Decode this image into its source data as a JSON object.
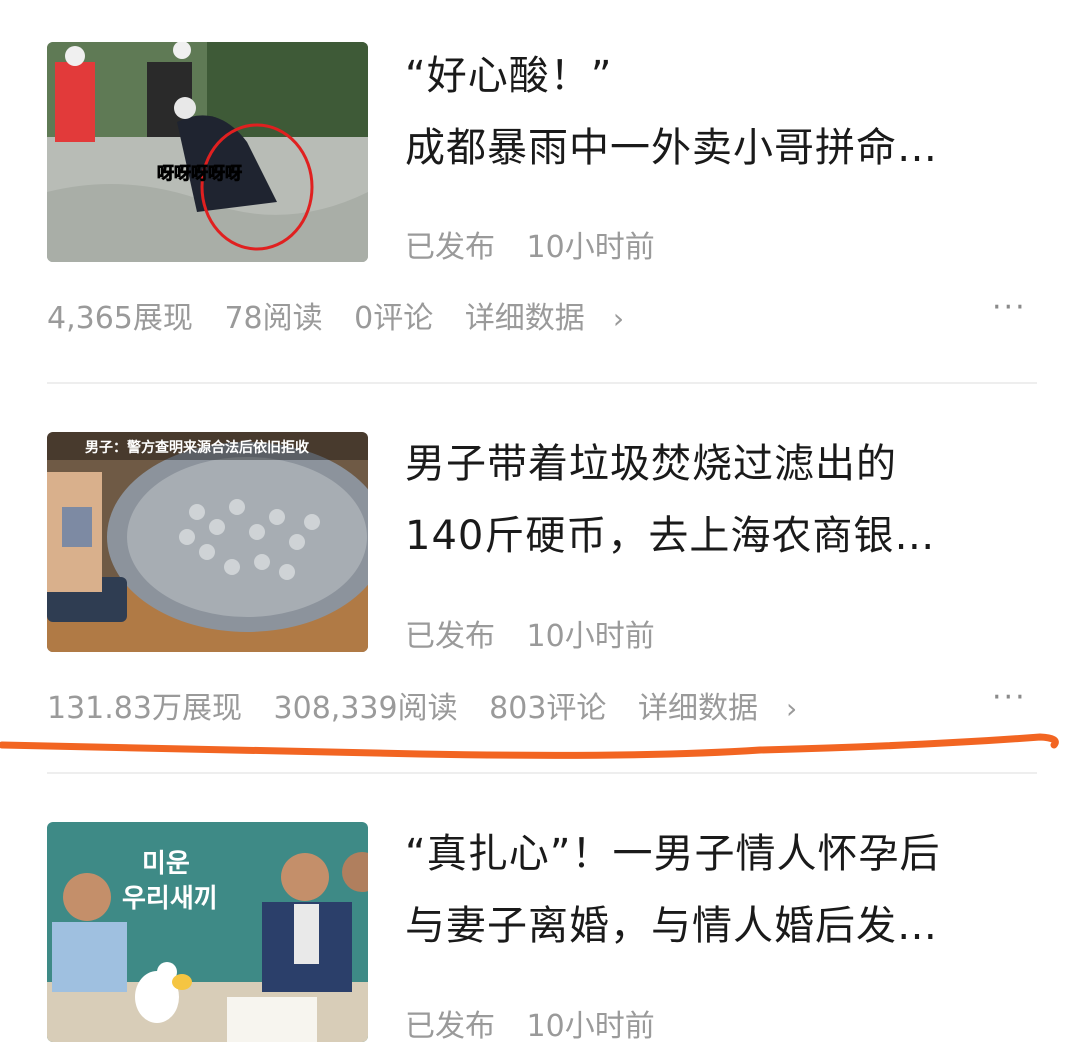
{
  "articles": [
    {
      "title_line1": "“好心酸！”",
      "title_line2": "成都暴雨中一外卖小哥拼命…",
      "status": "已发布",
      "time": "10小时前",
      "impressions": "4,365展现",
      "reads": "78阅读",
      "comments": "0评论",
      "details_label": "详细数据",
      "thumb_caption": "呀呀呀呀呀"
    },
    {
      "title_line1": "男子带着垃圾焚烧过滤出的",
      "title_line2": "140斤硬币，去上海农商银…",
      "status": "已发布",
      "time": "10小时前",
      "impressions": "131.83万展现",
      "reads": "308,339阅读",
      "comments": "803评论",
      "details_label": "详细数据",
      "thumb_caption": "男子：警方查明来源合法后依旧拒收"
    },
    {
      "title_line1": "“真扎心”！一男子情人怀孕后",
      "title_line2": "与妻子离婚，与情人婚后发…",
      "status": "已发布",
      "time": "10小时前",
      "thumb_caption_1": "미운",
      "thumb_caption_2": "우리새끼"
    }
  ],
  "more_icon": "more-dots-icon",
  "chevron_icon": "chevron-right-icon",
  "highlight_color": "#f26522"
}
